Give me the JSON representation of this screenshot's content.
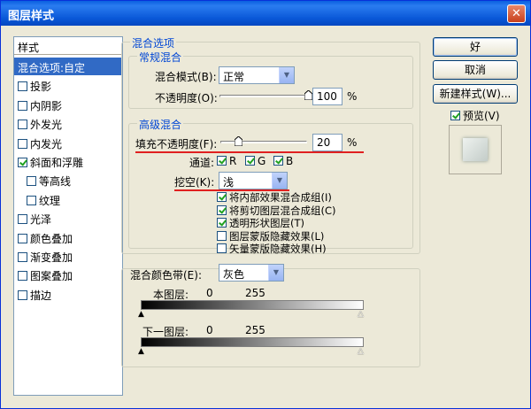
{
  "window": {
    "title": "图层样式",
    "close_label": "✕"
  },
  "sidebar": {
    "header": "样式",
    "items": [
      {
        "label": "混合选项:自定",
        "checkbox": false,
        "checked": false,
        "selected": true,
        "indent": false
      },
      {
        "label": "投影",
        "checkbox": true,
        "checked": false,
        "selected": false,
        "indent": false
      },
      {
        "label": "内阴影",
        "checkbox": true,
        "checked": false,
        "selected": false,
        "indent": false
      },
      {
        "label": "外发光",
        "checkbox": true,
        "checked": false,
        "selected": false,
        "indent": false
      },
      {
        "label": "内发光",
        "checkbox": true,
        "checked": false,
        "selected": false,
        "indent": false
      },
      {
        "label": "斜面和浮雕",
        "checkbox": true,
        "checked": true,
        "selected": false,
        "indent": false
      },
      {
        "label": "等高线",
        "checkbox": true,
        "checked": false,
        "selected": false,
        "indent": true
      },
      {
        "label": "纹理",
        "checkbox": true,
        "checked": false,
        "selected": false,
        "indent": true
      },
      {
        "label": "光泽",
        "checkbox": true,
        "checked": false,
        "selected": false,
        "indent": false
      },
      {
        "label": "颜色叠加",
        "checkbox": true,
        "checked": false,
        "selected": false,
        "indent": false
      },
      {
        "label": "渐变叠加",
        "checkbox": true,
        "checked": false,
        "selected": false,
        "indent": false
      },
      {
        "label": "图案叠加",
        "checkbox": true,
        "checked": false,
        "selected": false,
        "indent": false
      },
      {
        "label": "描边",
        "checkbox": true,
        "checked": false,
        "selected": false,
        "indent": false
      }
    ]
  },
  "blend": {
    "group_title": "混合选项",
    "general": {
      "title": "常规混合",
      "mode_label": "混合模式(B):",
      "mode_value": "正常",
      "opacity_label": "不透明度(O):",
      "opacity_value": "100",
      "opacity_fraction": 1.0,
      "unit": "%"
    },
    "advanced": {
      "title": "高级混合",
      "fill_label": "填充不透明度(F):",
      "fill_value": "20",
      "fill_fraction": 0.2,
      "unit": "%",
      "channels_label": "通道:",
      "channels": [
        {
          "label": "R",
          "checked": true
        },
        {
          "label": "G",
          "checked": true
        },
        {
          "label": "B",
          "checked": true
        }
      ],
      "knockout_label": "挖空(K):",
      "knockout_value": "浅",
      "options": [
        {
          "label": "将内部效果混合成组(I)",
          "checked": true
        },
        {
          "label": "将剪切图层混合成组(C)",
          "checked": true
        },
        {
          "label": "透明形状图层(T)",
          "checked": true
        },
        {
          "label": "图层蒙版隐藏效果(L)",
          "checked": false
        },
        {
          "label": "矢量蒙版隐藏效果(H)",
          "checked": false
        }
      ]
    },
    "blend_if": {
      "label": "混合颜色带(E):",
      "value": "灰色",
      "this_layer_label": "本图层:",
      "this_layer_low": "0",
      "this_layer_high": "255",
      "under_layer_label": "下一图层:",
      "under_layer_low": "0",
      "under_layer_high": "255"
    }
  },
  "buttons": {
    "ok": "好",
    "cancel": "取消",
    "new_style": "新建样式(W)...",
    "preview_label": "预览(V)",
    "preview_checked": true
  },
  "colors": {
    "accent": "#0046d5",
    "annotation": "#e02020",
    "selection": "#316ac5"
  }
}
